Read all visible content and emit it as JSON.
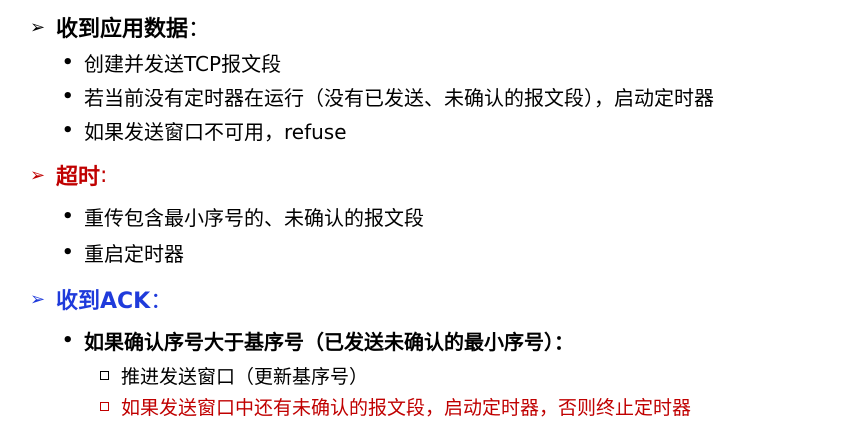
{
  "sections": [
    {
      "heading": "收到应用数据",
      "heading_suffix": "：",
      "color": "#000000",
      "items": [
        "创建并发送TCP报文段",
        "若当前没有定时器在运行（没有已发送、未确认的报文段），启动定时器",
        "如果发送窗口不可用，refuse"
      ]
    },
    {
      "heading": "超时",
      "heading_suffix": ":",
      "color": "#c00000",
      "items": [
        "重传包含最小序号的、未确认的报文段",
        "重启定时器"
      ]
    },
    {
      "heading": "收到ACK",
      "heading_suffix": "：",
      "color": "#1f3bdb",
      "items": [
        "如果确认序号大于基序号（已发送未确认的最小序号）："
      ],
      "subitems": [
        {
          "text": "推进发送窗口（更新基序号）",
          "color": "#000000"
        },
        {
          "text": "如果发送窗口中还有未确认的报文段，启动定时器，否则终止定时器",
          "color": "#c00000"
        }
      ]
    }
  ],
  "symbols": {
    "arrow": "➢",
    "bullet": "•"
  }
}
